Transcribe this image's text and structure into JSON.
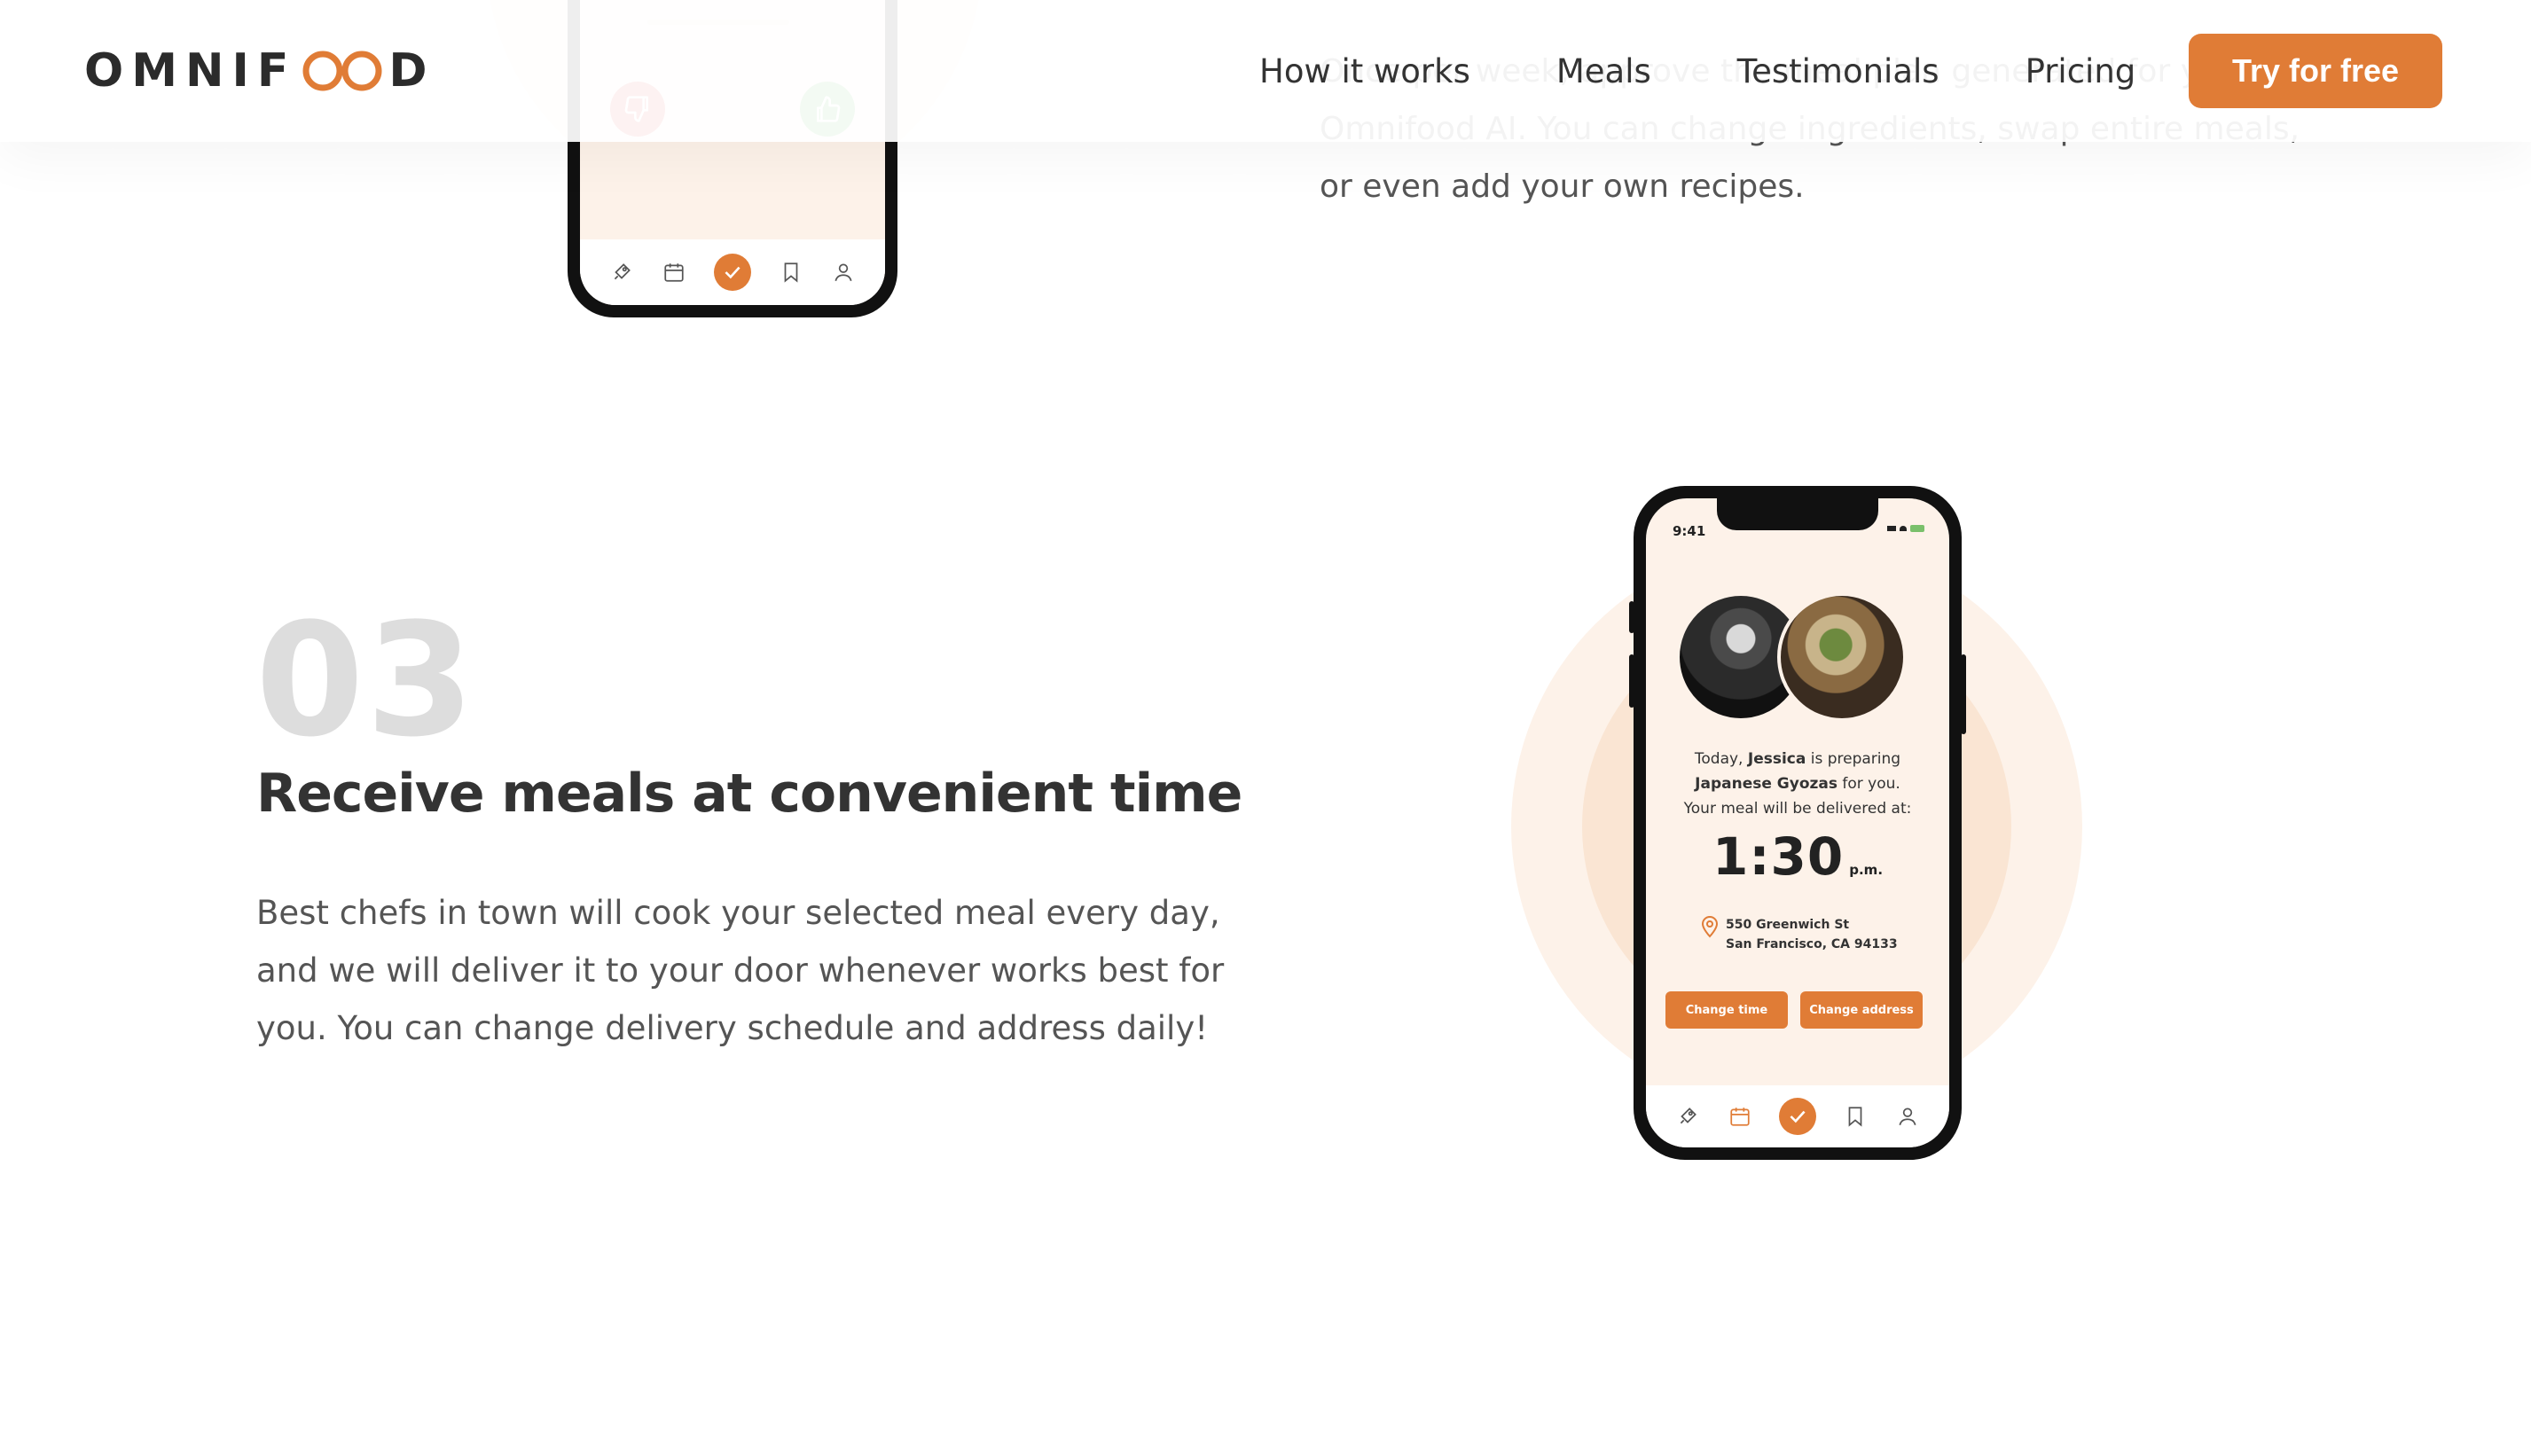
{
  "header": {
    "logo_text_left": "OMNIF",
    "logo_text_right": "D",
    "nav": [
      {
        "label": "How it works"
      },
      {
        "label": "Meals"
      },
      {
        "label": "Testimonials"
      },
      {
        "label": "Pricing"
      }
    ],
    "cta_label": "Try for free"
  },
  "previous_step": {
    "description": "Once per week, approve the meal plan generated for you by Omnifood AI. You can change ingredients, swap entire meals, or even add your own recipes."
  },
  "step": {
    "number": "03",
    "title": "Receive meals at convenient time",
    "description": "Best chefs in town will cook your selected meal every day, and we will deliver it to your door whenever works best for you. You can change delivery schedule and address daily!"
  },
  "phone_app": {
    "status_time": "9:41",
    "msg_prefix": "Today,",
    "chef_name": "Jessica",
    "msg_mid": "is preparing",
    "meal_name": "Japanese Gyozas",
    "msg_suffix": "for you.",
    "msg_line3": "Your meal will be delivered at:",
    "delivery_time": "1:30",
    "delivery_period": "p.m.",
    "address_line1": "550 Greenwich St",
    "address_line2": "San Francisco, CA 94133",
    "change_time_label": "Change time",
    "change_address_label": "Change address",
    "tabs": [
      "rocket-icon",
      "calendar-icon",
      "check-icon",
      "bookmark-icon",
      "user-icon"
    ]
  },
  "colors": {
    "accent": "#e07c36",
    "step_number": "#dddddd",
    "circle_light": "#fdf2e9",
    "circle_dark": "#fae5d3",
    "dislike": "#e0484a",
    "like": "#51b955"
  }
}
